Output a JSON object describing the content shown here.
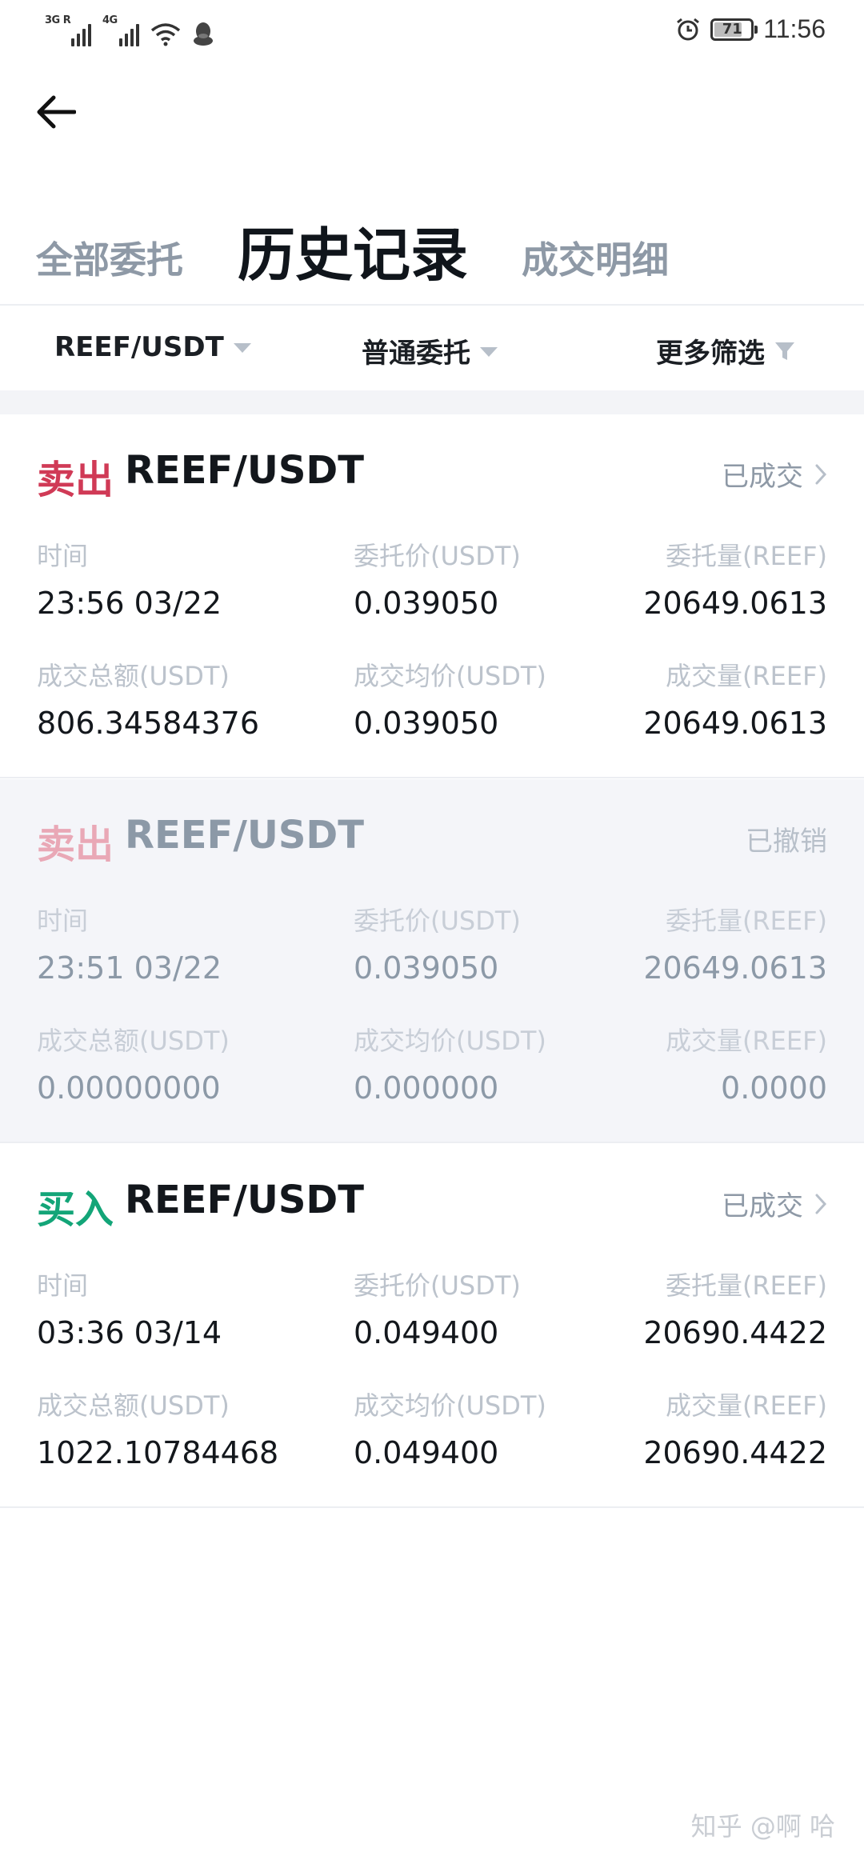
{
  "status_bar": {
    "signal1_label": "3G R",
    "signal2_label": "4G",
    "battery": "71",
    "time": "11:56"
  },
  "tabs": [
    {
      "label": "全部委托",
      "active": false
    },
    {
      "label": "历史记录",
      "active": true
    },
    {
      "label": "成交明细",
      "active": false
    }
  ],
  "filters": {
    "pair": "REEF/USDT",
    "order_type": "普通委托",
    "more": "更多筛选"
  },
  "labels": {
    "time": "时间",
    "order_price": "委托价(USDT)",
    "order_amount": "委托量(REEF)",
    "filled_total": "成交总额(USDT)",
    "avg_price": "成交均价(USDT)",
    "filled_amount": "成交量(REEF)"
  },
  "orders": [
    {
      "side": "卖出",
      "pair": "REEF/USDT",
      "status": "已成交",
      "time": "23:56 03/22",
      "order_price": "0.039050",
      "order_amount": "20649.0613",
      "filled_total": "806.34584376",
      "avg_price": "0.039050",
      "filled_amount": "20649.0613"
    },
    {
      "side": "卖出",
      "pair": "REEF/USDT",
      "status": "已撤销",
      "time": "23:51 03/22",
      "order_price": "0.039050",
      "order_amount": "20649.0613",
      "filled_total": "0.00000000",
      "avg_price": "0.000000",
      "filled_amount": "0.0000"
    },
    {
      "side": "买入",
      "pair": "REEF/USDT",
      "status": "已成交",
      "time": "03:36 03/14",
      "order_price": "0.049400",
      "order_amount": "20690.4422",
      "filled_total": "1022.10784468",
      "avg_price": "0.049400",
      "filled_amount": "20690.4422"
    }
  ],
  "watermark": "知乎 @啊 哈",
  "colors": {
    "sell": "#d03a56",
    "buy": "#13a578",
    "muted": "#8e99a6"
  }
}
